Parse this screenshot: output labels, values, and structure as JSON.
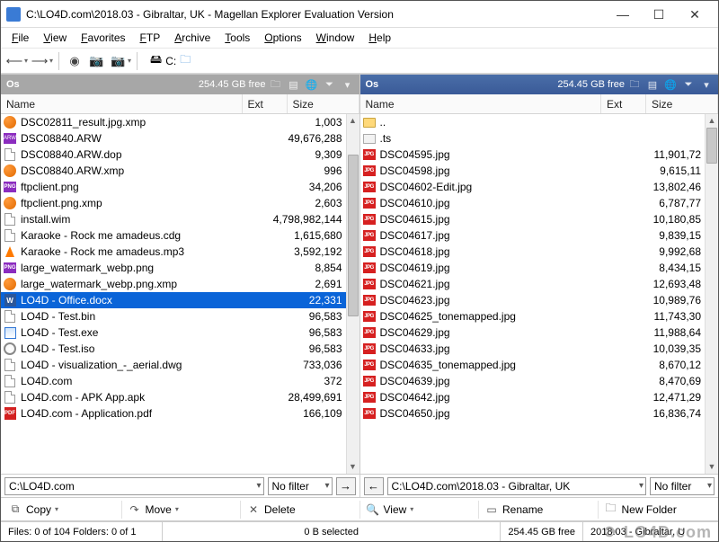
{
  "window": {
    "title": "C:\\LO4D.com\\2018.03 - Gibraltar, UK - Magellan Explorer  Evaluation Version"
  },
  "menu": [
    "File",
    "View",
    "Favorites",
    "FTP",
    "Archive",
    "Tools",
    "Options",
    "Window",
    "Help"
  ],
  "drivebar": {
    "drive": "C:"
  },
  "left": {
    "label": "Os",
    "free": "254.45 GB free",
    "cols": {
      "name": "Name",
      "ext": "Ext",
      "size": "Size"
    },
    "path": "C:\\LO4D.com",
    "filter": "No filter",
    "files": [
      {
        "icon": "xmp",
        "name": "DSC02811_result.jpg.xmp",
        "size": "1,003"
      },
      {
        "icon": "arw",
        "name": "DSC08840.ARW",
        "size": "49,676,288"
      },
      {
        "icon": "generic",
        "name": "DSC08840.ARW.dop",
        "size": "9,309"
      },
      {
        "icon": "xmp",
        "name": "DSC08840.ARW.xmp",
        "size": "996"
      },
      {
        "icon": "png",
        "name": "ftpclient.png",
        "size": "34,206"
      },
      {
        "icon": "xmp",
        "name": "ftpclient.png.xmp",
        "size": "2,603"
      },
      {
        "icon": "generic",
        "name": "install.wim",
        "size": "4,798,982,144"
      },
      {
        "icon": "generic",
        "name": "Karaoke - Rock me amadeus.cdg",
        "size": "1,615,680"
      },
      {
        "icon": "vlc",
        "name": "Karaoke - Rock me amadeus.mp3",
        "size": "3,592,192"
      },
      {
        "icon": "png",
        "name": "large_watermark_webp.png",
        "size": "8,854"
      },
      {
        "icon": "xmp",
        "name": "large_watermark_webp.png.xmp",
        "size": "2,691"
      },
      {
        "icon": "word",
        "name": "LO4D - Office.docx",
        "size": "22,331",
        "selected": true
      },
      {
        "icon": "generic",
        "name": "LO4D - Test.bin",
        "size": "96,583"
      },
      {
        "icon": "exe",
        "name": "LO4D - Test.exe",
        "size": "96,583"
      },
      {
        "icon": "iso",
        "name": "LO4D - Test.iso",
        "size": "96,583"
      },
      {
        "icon": "generic",
        "name": "LO4D - visualization_-_aerial.dwg",
        "size": "733,036"
      },
      {
        "icon": "generic",
        "name": "LO4D.com",
        "size": "372"
      },
      {
        "icon": "generic",
        "name": "LO4D.com - APK App.apk",
        "size": "28,499,691"
      },
      {
        "icon": "pdf",
        "name": "LO4D.com - Application.pdf",
        "size": "166,109"
      }
    ],
    "scroll": {
      "thumbTop": 30,
      "thumbHeight": 180
    }
  },
  "right": {
    "label": "Os",
    "free": "254.45 GB free",
    "cols": {
      "name": "Name",
      "ext": "Ext",
      "size": "Size"
    },
    "path": "C:\\LO4D.com\\2018.03 - Gibraltar, UK",
    "filter": "No filter",
    "files": [
      {
        "icon": "folder",
        "name": "..",
        "size": ""
      },
      {
        "icon": "ts",
        "name": ".ts",
        "size": ""
      },
      {
        "icon": "jpg",
        "name": "DSC04595.jpg",
        "size": "11,901,72"
      },
      {
        "icon": "jpg",
        "name": "DSC04598.jpg",
        "size": "9,615,11"
      },
      {
        "icon": "jpg",
        "name": "DSC04602-Edit.jpg",
        "size": "13,802,46"
      },
      {
        "icon": "jpg",
        "name": "DSC04610.jpg",
        "size": "6,787,77"
      },
      {
        "icon": "jpg",
        "name": "DSC04615.jpg",
        "size": "10,180,85"
      },
      {
        "icon": "jpg",
        "name": "DSC04617.jpg",
        "size": "9,839,15"
      },
      {
        "icon": "jpg",
        "name": "DSC04618.jpg",
        "size": "9,992,68"
      },
      {
        "icon": "jpg",
        "name": "DSC04619.jpg",
        "size": "8,434,15"
      },
      {
        "icon": "jpg",
        "name": "DSC04621.jpg",
        "size": "12,693,48"
      },
      {
        "icon": "jpg",
        "name": "DSC04623.jpg",
        "size": "10,989,76"
      },
      {
        "icon": "jpg",
        "name": "DSC04625_tonemapped.jpg",
        "size": "11,743,30"
      },
      {
        "icon": "jpg",
        "name": "DSC04629.jpg",
        "size": "11,988,64"
      },
      {
        "icon": "jpg",
        "name": "DSC04633.jpg",
        "size": "10,039,35"
      },
      {
        "icon": "jpg",
        "name": "DSC04635_tonemapped.jpg",
        "size": "8,670,12"
      },
      {
        "icon": "jpg",
        "name": "DSC04639.jpg",
        "size": "8,470,69"
      },
      {
        "icon": "jpg",
        "name": "DSC04642.jpg",
        "size": "12,471,29"
      },
      {
        "icon": "jpg",
        "name": "DSC04650.jpg",
        "size": "16,836,74"
      }
    ],
    "scroll": {
      "thumbTop": 0,
      "thumbHeight": 40
    }
  },
  "actions": {
    "copy": "Copy",
    "move": "Move",
    "delete": "Delete",
    "view": "View",
    "rename": "Rename",
    "newfolder": "New Folder"
  },
  "status": {
    "left": "Files: 0 of 104   Folders: 0 of 1",
    "mid": "0 B selected",
    "right1": "254.45 GB free",
    "right2": "2018.03 - Gibraltar, U"
  },
  "watermark": "LO4D.com"
}
